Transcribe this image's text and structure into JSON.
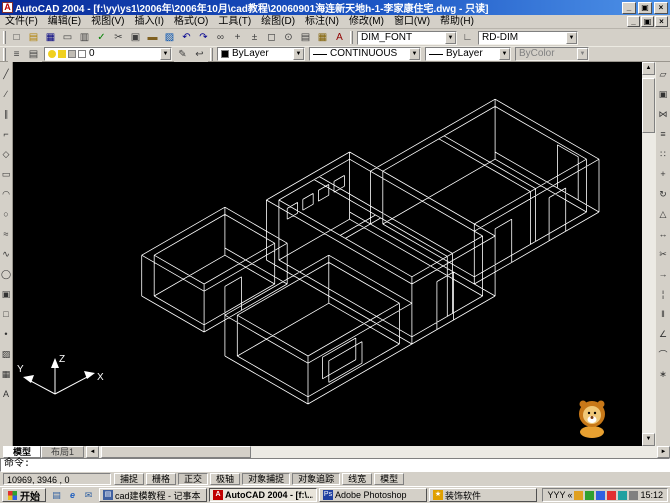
{
  "window": {
    "title": "AutoCAD 2004 - [f:\\yy\\ys1\\2006年\\2006年10月\\cad教程\\20060901海连新天地h-1-李家康住宅.dwg - 只读]",
    "controls": {
      "minimize": "_",
      "restore": "▣",
      "close": "×"
    }
  },
  "menu": {
    "items": [
      {
        "id": "file",
        "label": "文件(F)"
      },
      {
        "id": "edit",
        "label": "编辑(E)"
      },
      {
        "id": "view",
        "label": "视图(V)"
      },
      {
        "id": "insert",
        "label": "插入(I)"
      },
      {
        "id": "format",
        "label": "格式(O)"
      },
      {
        "id": "tools",
        "label": "工具(T)"
      },
      {
        "id": "draw",
        "label": "绘图(D)"
      },
      {
        "id": "dimension",
        "label": "标注(N)"
      },
      {
        "id": "modify",
        "label": "修改(M)"
      },
      {
        "id": "window",
        "label": "窗口(W)"
      },
      {
        "id": "help",
        "label": "帮助(H)"
      }
    ],
    "doc_controls": {
      "minimize": "_",
      "restore": "▣",
      "close": "×"
    }
  },
  "toolbar1": {
    "icons": [
      {
        "name": "new-file-icon",
        "g": "□",
        "c": "#404040"
      },
      {
        "name": "open-file-icon",
        "g": "▤",
        "c": "#b08000"
      },
      {
        "name": "save-icon",
        "g": "▦",
        "c": "#000080"
      },
      {
        "name": "plot-icon",
        "g": "▭",
        "c": "#404040"
      },
      {
        "name": "plot-preview-icon",
        "g": "▥",
        "c": "#404040"
      },
      {
        "name": "spelling-icon",
        "g": "✓",
        "c": "#008000"
      },
      {
        "name": "cut-icon",
        "g": "✂",
        "c": "#404040"
      },
      {
        "name": "copy-icon",
        "g": "▣",
        "c": "#404040"
      },
      {
        "name": "paste-icon",
        "g": "▬",
        "c": "#806020"
      },
      {
        "name": "match-properties-icon",
        "g": "▨",
        "c": "#0050b0"
      },
      {
        "name": "undo-icon",
        "g": "↶",
        "c": "#000090"
      },
      {
        "name": "redo-icon",
        "g": "↷",
        "c": "#000090"
      },
      {
        "name": "insert-hyperlink-icon",
        "g": "∞",
        "c": "#404040"
      },
      {
        "name": "pan-icon",
        "g": "+",
        "c": "#404040"
      },
      {
        "name": "zoom-realtime-icon",
        "g": "±",
        "c": "#404040"
      },
      {
        "name": "zoom-window-icon",
        "g": "◻",
        "c": "#404040"
      },
      {
        "name": "zoom-previous-icon",
        "g": "⊙",
        "c": "#404040"
      },
      {
        "name": "properties-icon",
        "g": "▤",
        "c": "#404040"
      },
      {
        "name": "designcenter-icon",
        "g": "▦",
        "c": "#806000"
      },
      {
        "name": "text-style-icon",
        "g": "A",
        "c": "#900000"
      }
    ],
    "icons2": [
      {
        "name": "dim-style-icon",
        "g": "∟",
        "c": "#404040"
      }
    ],
    "text_style": "DIM_FONT",
    "dim_style": "RD-DIM"
  },
  "toolbar2": {
    "icons_left": [
      {
        "name": "layers-icon",
        "g": "≡",
        "c": "#404040"
      },
      {
        "name": "layer-properties-icon",
        "g": "▤",
        "c": "#404040"
      }
    ],
    "icons_mid": [
      {
        "name": "make-object-layer-icon",
        "g": "✎",
        "c": "#404040"
      },
      {
        "name": "layer-previous-icon",
        "g": "↩",
        "c": "#404040"
      }
    ],
    "layer": "0",
    "color": "ByLayer",
    "linetype": "CONTINUOUS",
    "lineweight": "ByLayer",
    "plotstyle": "ByColor"
  },
  "draw_toolbar": {
    "icons": [
      {
        "name": "line-icon",
        "g": "╱",
        "c": "#333333"
      },
      {
        "name": "construction-line-icon",
        "g": "∕",
        "c": "#333333"
      },
      {
        "name": "multiline-icon",
        "g": "∥",
        "c": "#333333"
      },
      {
        "name": "polyline-icon",
        "g": "⌐",
        "c": "#333333"
      },
      {
        "name": "polygon-icon",
        "g": "◇",
        "c": "#333333"
      },
      {
        "name": "rectangle-icon",
        "g": "▭",
        "c": "#333333"
      },
      {
        "name": "arc-icon",
        "g": "◠",
        "c": "#333333"
      },
      {
        "name": "circle-icon",
        "g": "○",
        "c": "#333333"
      },
      {
        "name": "revcloud-icon",
        "g": "≈",
        "c": "#333333"
      },
      {
        "name": "spline-icon",
        "g": "∿",
        "c": "#333333"
      },
      {
        "name": "ellipse-icon",
        "g": "◯",
        "c": "#333333"
      },
      {
        "name": "insert-block-icon",
        "g": "▣",
        "c": "#333333"
      },
      {
        "name": "make-block-icon",
        "g": "□",
        "c": "#333333"
      },
      {
        "name": "point-icon",
        "g": "•",
        "c": "#333333"
      },
      {
        "name": "hatch-icon",
        "g": "▨",
        "c": "#333333"
      },
      {
        "name": "region-icon",
        "g": "▦",
        "c": "#333333"
      },
      {
        "name": "mtext-icon",
        "g": "A",
        "c": "#333333"
      }
    ]
  },
  "modify_toolbar": {
    "icons": [
      {
        "name": "erase-icon",
        "g": "▱",
        "c": "#333333"
      },
      {
        "name": "copy-object-icon",
        "g": "▣",
        "c": "#333333"
      },
      {
        "name": "mirror-icon",
        "g": "⋈",
        "c": "#333333"
      },
      {
        "name": "offset-icon",
        "g": "≡",
        "c": "#333333"
      },
      {
        "name": "array-icon",
        "g": "∷",
        "c": "#333333"
      },
      {
        "name": "move-icon",
        "g": "+",
        "c": "#333333"
      },
      {
        "name": "rotate-icon",
        "g": "↻",
        "c": "#333333"
      },
      {
        "name": "scale-icon",
        "g": "△",
        "c": "#333333"
      },
      {
        "name": "stretch-icon",
        "g": "↔",
        "c": "#333333"
      },
      {
        "name": "trim-icon",
        "g": "✂",
        "c": "#333333"
      },
      {
        "name": "extend-icon",
        "g": "→",
        "c": "#333333"
      },
      {
        "name": "break-at-point-icon",
        "g": "¦",
        "c": "#333333"
      },
      {
        "name": "break-icon",
        "g": "‖",
        "c": "#333333"
      },
      {
        "name": "chamfer-icon",
        "g": "∠",
        "c": "#333333"
      },
      {
        "name": "fillet-icon",
        "g": "⌒",
        "c": "#333333"
      },
      {
        "name": "explode-icon",
        "g": "∗",
        "c": "#333333"
      }
    ]
  },
  "canvas": {
    "ucs": {
      "x": "X",
      "y": "Y",
      "z": "Z"
    },
    "mascot": "lion-desktop-pet"
  },
  "tabs": {
    "items": [
      {
        "id": "model",
        "label": "模型",
        "active": true
      },
      {
        "id": "layout1",
        "label": "布局1",
        "active": false
      }
    ]
  },
  "command": {
    "prompt": "命令:"
  },
  "status": {
    "coordinates": "10969, 3946 , 0",
    "toggles": [
      {
        "id": "snap",
        "label": "捕捉",
        "pressed": false
      },
      {
        "id": "grid",
        "label": "栅格",
        "pressed": false
      },
      {
        "id": "ortho",
        "label": "正交",
        "pressed": true
      },
      {
        "id": "polar",
        "label": "极轴",
        "pressed": false
      },
      {
        "id": "osnap",
        "label": "对象捕捉",
        "pressed": true
      },
      {
        "id": "otrack",
        "label": "对象追踪",
        "pressed": true
      },
      {
        "id": "lwt",
        "label": "线宽",
        "pressed": false
      },
      {
        "id": "model-space",
        "label": "模型",
        "pressed": false
      }
    ]
  },
  "taskbar": {
    "start_label": "开始",
    "quick_launch": [
      {
        "name": "show-desktop-icon",
        "g": "▤",
        "c": "#3060a0"
      },
      {
        "name": "ie-icon",
        "g": "e",
        "c": "#2060c0"
      },
      {
        "name": "outlook-icon",
        "g": "✉",
        "c": "#3060a0"
      }
    ],
    "tasks": [
      {
        "id": "notepad-task",
        "label": "cad建模教程 - 记事本",
        "active": false,
        "icon_glyph": "▤",
        "icon_color": "#4060a0"
      },
      {
        "id": "autocad-task",
        "label": "AutoCAD 2004 - [f:\\...",
        "active": true,
        "icon_glyph": "A",
        "icon_color": "#c00000"
      },
      {
        "id": "photoshop-task",
        "label": "Adobe Photoshop",
        "active": false,
        "icon_glyph": "Ps",
        "icon_color": "#2040a0"
      },
      {
        "id": "decorator-task",
        "label": "装饰软件",
        "active": false,
        "icon_glyph": "★",
        "icon_color": "#e0a000"
      }
    ],
    "tray": {
      "ime": "YYY",
      "time": "15:12",
      "icons": [
        {
          "name": "pet-tray-icon",
          "c": "#e0a020"
        },
        {
          "name": "ime-pen-icon",
          "c": "#30a030"
        },
        {
          "name": "volume-icon",
          "c": "#3060e0"
        },
        {
          "name": "antivirus-icon",
          "c": "#e03030"
        },
        {
          "name": "messenger-icon",
          "c": "#20a0a0"
        },
        {
          "name": "network-icon",
          "c": "#808080"
        }
      ]
    }
  }
}
